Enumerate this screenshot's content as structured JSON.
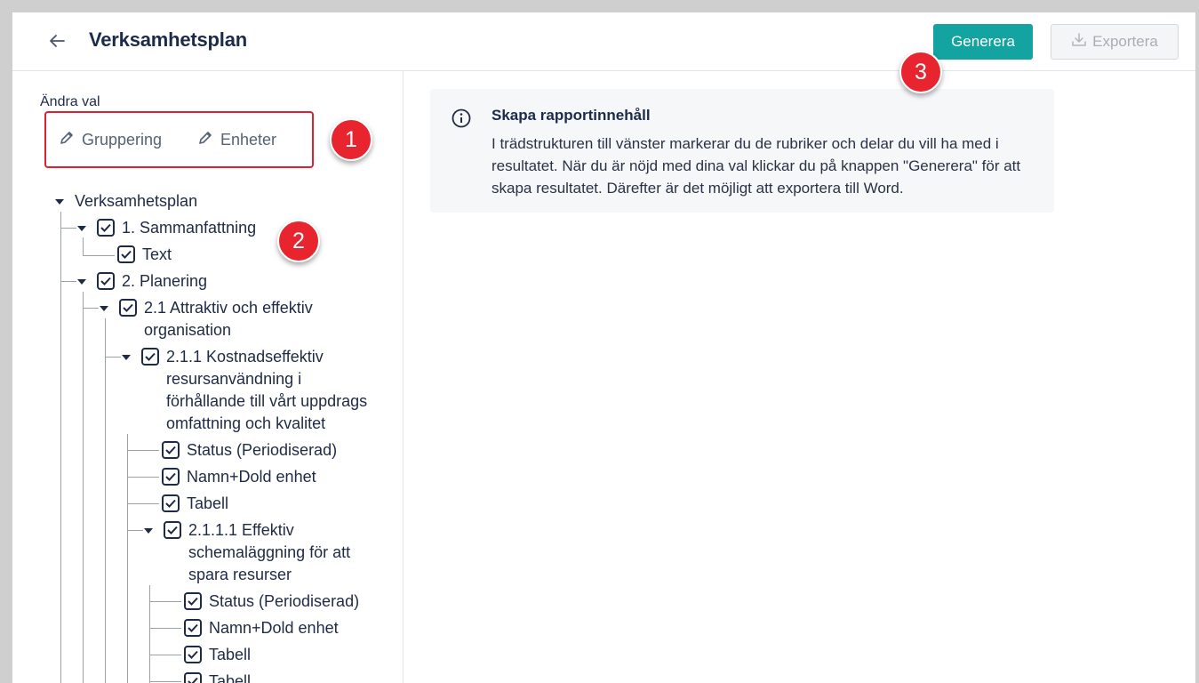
{
  "header": {
    "back_icon": "arrow-left-icon",
    "title": "Verksamhetsplan",
    "generate_label": "Generera",
    "export_label": "Exportera",
    "export_icon": "download-icon",
    "accent": "#13a3a0"
  },
  "sidebar": {
    "section_label": "Ändra val",
    "edit_links": [
      {
        "label": "Gruppering",
        "icon": "pencil-icon"
      },
      {
        "label": "Enheter",
        "icon": "pencil-icon"
      }
    ],
    "tree": {
      "root": "Verksamhetsplan",
      "n1": "1. Sammanfattning",
      "n1_text": "Text",
      "n2": "2. Planering",
      "n21": "2.1 Attraktiv och effektiv organisation",
      "n211": "2.1.1 Kostnadseffektiv resursanvändning i förhållande till vårt uppdrags omfattning och kvalitet",
      "n211_a": "Status (Periodiserad)",
      "n211_b": "Namn+Dold enhet",
      "n211_c": "Tabell",
      "n2111": "2.1.1.1 Effektiv schemaläggning för att spara resurser",
      "n2111_a": "Status (Periodiserad)",
      "n2111_b": "Namn+Dold enhet",
      "n2111_c": "Tabell",
      "n2111_d": "Tabell"
    }
  },
  "badges": [
    "1",
    "2",
    "3"
  ],
  "info": {
    "icon": "info-icon",
    "title": "Skapa rapportinnehåll",
    "body": "I trädstrukturen till vänster markerar du de rubriker och delar du vill ha med i resultatet. När du är nöjd med dina val klickar du på knappen \"Generera\" för att skapa resultatet. Därefter är det möjligt att exportera till Word."
  }
}
